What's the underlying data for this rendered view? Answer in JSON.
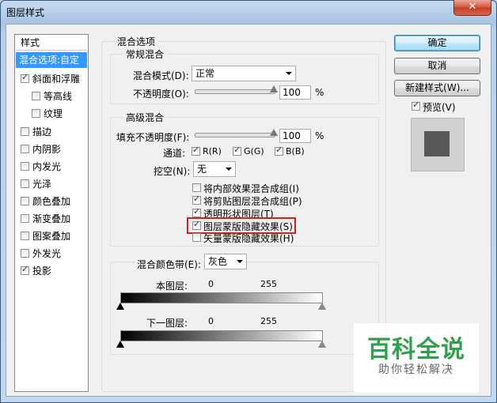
{
  "window": {
    "title": "图层样式",
    "close_symbol": "✕"
  },
  "style_list": {
    "header": "样式",
    "items": [
      {
        "label": "混合选项:自定",
        "checked": null,
        "selected": true
      },
      {
        "label": "斜面和浮雕",
        "checked": true
      },
      {
        "label": "等高线",
        "checked": false,
        "indent": true
      },
      {
        "label": "纹理",
        "checked": false,
        "indent": true
      },
      {
        "label": "描边",
        "checked": false
      },
      {
        "label": "内阴影",
        "checked": false
      },
      {
        "label": "内发光",
        "checked": false
      },
      {
        "label": "光泽",
        "checked": false
      },
      {
        "label": "颜色叠加",
        "checked": false
      },
      {
        "label": "渐变叠加",
        "checked": false
      },
      {
        "label": "图案叠加",
        "checked": false
      },
      {
        "label": "外发光",
        "checked": false
      },
      {
        "label": "投影",
        "checked": true
      }
    ]
  },
  "blend_options": {
    "title": "混合选项",
    "general": {
      "title": "常规混合",
      "mode_label": "混合模式(D):",
      "mode_value": "正常",
      "opacity_label": "不透明度(O):",
      "opacity_value": "100",
      "opacity_unit": "%",
      "opacity_fraction": 1.0
    },
    "advanced": {
      "title": "高级混合",
      "fill_label": "填充不透明度(F):",
      "fill_value": "100",
      "fill_unit": "%",
      "fill_fraction": 1.0,
      "channels_label": "通道:",
      "channels": [
        {
          "label": "R(R)",
          "checked": true
        },
        {
          "label": "G(G)",
          "checked": true
        },
        {
          "label": "B(B)",
          "checked": true
        }
      ],
      "knockout_label": "挖空(N):",
      "knockout_value": "无",
      "options": [
        {
          "label": "将内部效果混合成组(I)",
          "checked": false
        },
        {
          "label": "将剪贴图层混合成组(P)",
          "checked": true
        },
        {
          "label": "透明形状图层(T)",
          "checked": true
        },
        {
          "label": "图层蒙版隐藏效果(S)",
          "checked": true
        },
        {
          "label": "矢量蒙版隐藏效果(H)",
          "checked": false
        }
      ]
    },
    "blend_if": {
      "label": "混合颜色带(E):",
      "value": "灰色",
      "this_layer": {
        "label": "本图层:",
        "min": "0",
        "max": "255"
      },
      "underlying": {
        "label": "下一图层:",
        "min": "0",
        "max": "255"
      }
    }
  },
  "buttons": {
    "ok": "确定",
    "cancel": "取消",
    "new_style": "新建样式(W)...",
    "preview_label": "预览(V)",
    "preview_checked": true
  },
  "watermark": {
    "main": "百科全说",
    "sub": "助你轻松解决"
  },
  "colors": {
    "selection": "#3399ff",
    "highlight_box": "#d21f1f",
    "watermark_green": "#2fa14a"
  }
}
